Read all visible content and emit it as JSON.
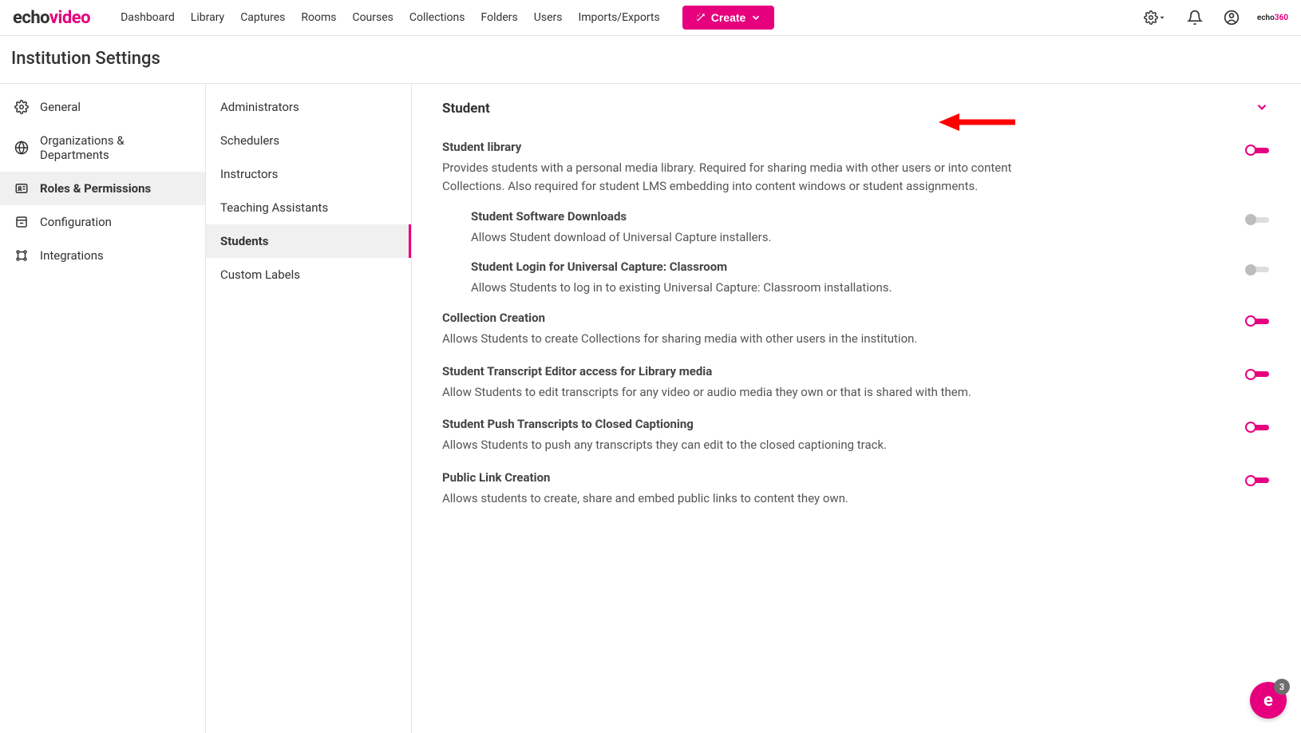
{
  "brand": {
    "part1": "echo",
    "part2": "video"
  },
  "topnav": {
    "links": [
      "Dashboard",
      "Library",
      "Captures",
      "Rooms",
      "Courses",
      "Collections",
      "Folders",
      "Users",
      "Imports/Exports"
    ],
    "create": "Create"
  },
  "page_title": "Institution Settings",
  "sidebar1": {
    "items": [
      {
        "label": "General",
        "icon": "gear"
      },
      {
        "label": "Organizations & Departments",
        "icon": "globe"
      },
      {
        "label": "Roles & Permissions",
        "icon": "id"
      },
      {
        "label": "Configuration",
        "icon": "box"
      },
      {
        "label": "Integrations",
        "icon": "nodes"
      }
    ],
    "active_index": 2
  },
  "sidebar2": {
    "items": [
      "Administrators",
      "Schedulers",
      "Instructors",
      "Teaching Assistants",
      "Students",
      "Custom Labels"
    ],
    "active_index": 4
  },
  "section": {
    "heading": "Student",
    "settings": [
      {
        "title": "Student library",
        "desc": "Provides students with a personal media library. Required for sharing media with other users or into content Collections. Also required for student LMS embedding into content windows or student assignments.",
        "toggle": "on",
        "children": [
          {
            "title": "Student Software Downloads",
            "desc": "Allows Student download of Universal Capture installers.",
            "toggle": "off"
          },
          {
            "title": "Student Login for Universal Capture: Classroom",
            "desc": "Allows Students to log in to existing Universal Capture: Classroom installations.",
            "toggle": "off"
          }
        ]
      },
      {
        "title": "Collection Creation",
        "desc": "Allows Students to create Collections for sharing media with other users in the institution.",
        "toggle": "on"
      },
      {
        "title": "Student Transcript Editor access for Library media",
        "desc": "Allow Students to edit transcripts for any video or audio media they own or that is shared with them.",
        "toggle": "on"
      },
      {
        "title": "Student Push Transcripts to Closed Captioning",
        "desc": "Allows Students to push any transcripts they can edit to the closed captioning track.",
        "toggle": "on"
      },
      {
        "title": "Public Link Creation",
        "desc": "Allows students to create, share and embed public links to content they own.",
        "toggle": "on"
      }
    ]
  },
  "chat_badge": "3",
  "colors": {
    "accent": "#e6007e"
  }
}
